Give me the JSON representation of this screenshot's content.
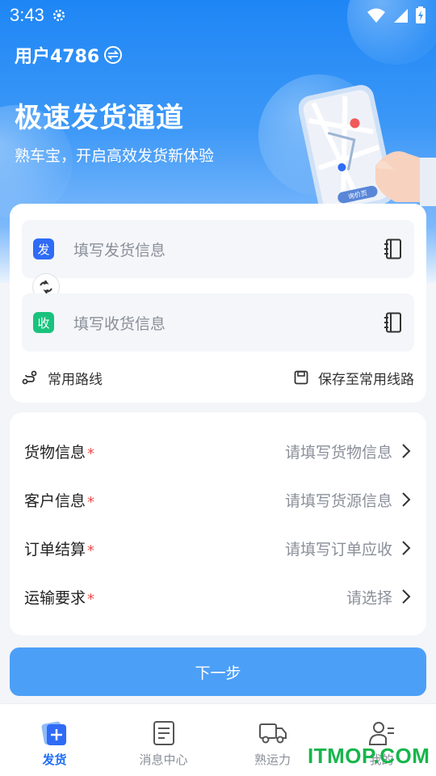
{
  "status_bar": {
    "time": "3:43"
  },
  "header": {
    "user": "用户4786",
    "title": "极速发货通道",
    "subtitle": "熟车宝，开启高效发货新体验",
    "illustration_text": "询价页"
  },
  "route": {
    "sender_tag": "发",
    "sender_placeholder": "填写发货信息",
    "receiver_tag": "收",
    "receiver_placeholder": "填写收货信息",
    "common_routes": "常用路线",
    "save_route": "保存至常用线路",
    "sender_color": "#2f6bf5",
    "receiver_color": "#19c37d"
  },
  "info_rows": [
    {
      "label": "货物信息",
      "required": "*",
      "value": "请填写货物信息"
    },
    {
      "label": "客户信息",
      "required": "*",
      "value": "请填写货源信息"
    },
    {
      "label": "订单结算",
      "required": "*",
      "value": "请填写订单应收"
    },
    {
      "label": "运输要求",
      "required": "*",
      "value": "请选择"
    }
  ],
  "next_button": "下一步",
  "tabs": [
    {
      "label": "发货",
      "icon": "ship-plus-icon",
      "active": true
    },
    {
      "label": "消息中心",
      "icon": "document-icon",
      "active": false
    },
    {
      "label": "熟运力",
      "icon": "truck-icon",
      "active": false
    },
    {
      "label": "我的",
      "icon": "user-icon",
      "active": false
    }
  ],
  "watermark": "ITMOP.COM",
  "colors": {
    "primary": "#1e86f5",
    "button": "#4c9ff7",
    "required": "#f04b4b",
    "active_tab": "#1e6ff5"
  }
}
